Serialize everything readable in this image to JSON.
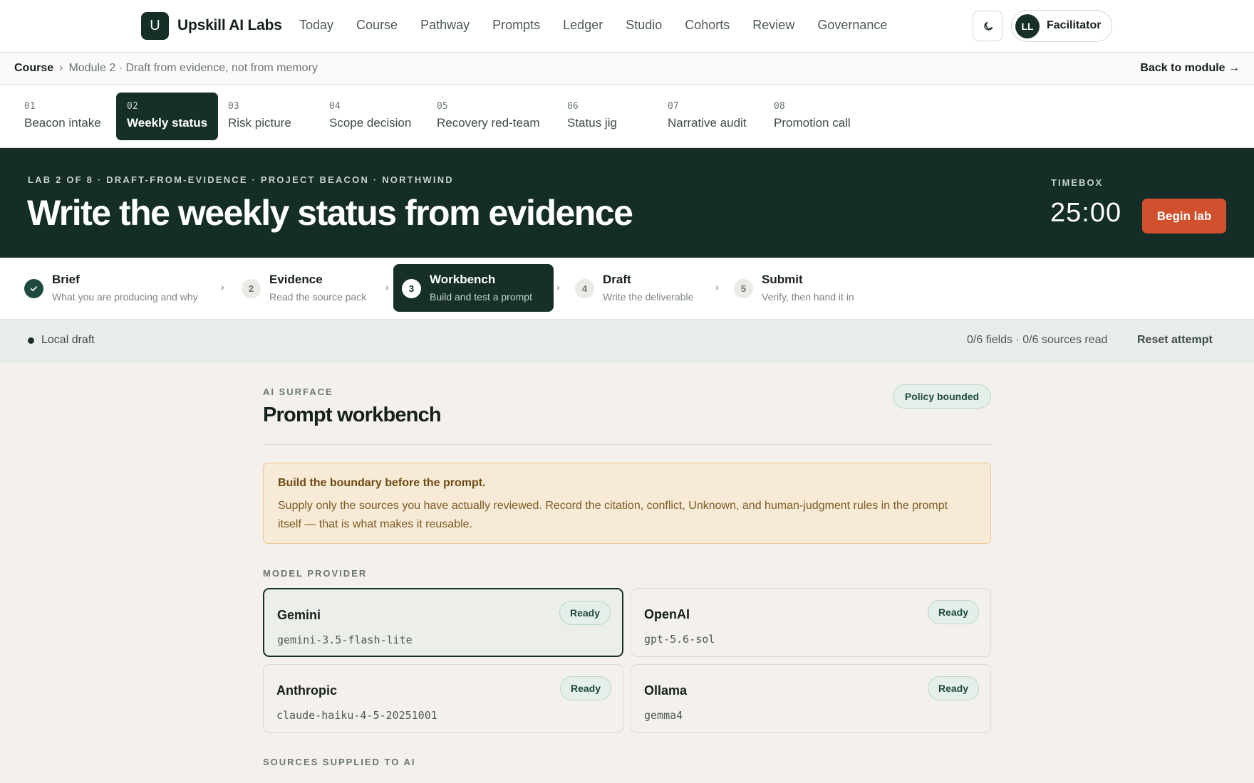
{
  "app": {
    "logo_letter": "U",
    "brand": "Upskill AI Labs",
    "nav": [
      "Today",
      "Course",
      "Pathway",
      "Prompts",
      "Ledger",
      "Studio",
      "Cohorts",
      "Review",
      "Governance"
    ],
    "user_initials": "LL",
    "user_role": "Facilitator"
  },
  "breadcrumb": {
    "root": "Course",
    "sep": "›",
    "current": "Module 2 · Draft from evidence, not from memory",
    "back": "Back to module →"
  },
  "lab_tabs": [
    {
      "num": "01",
      "label": "Beacon intake"
    },
    {
      "num": "02",
      "label": "Weekly status",
      "active": true
    },
    {
      "num": "03",
      "label": "Risk picture"
    },
    {
      "num": "04",
      "label": "Scope decision"
    },
    {
      "num": "05",
      "label": "Recovery red-team"
    },
    {
      "num": "06",
      "label": "Status jig"
    },
    {
      "num": "07",
      "label": "Narrative audit"
    },
    {
      "num": "08",
      "label": "Promotion call"
    }
  ],
  "hero": {
    "kicker": "LAB 2 OF 8 · DRAFT-FROM-EVIDENCE · PROJECT BEACON · NORTHWIND",
    "title": "Write the weekly status from evidence",
    "timebox_label": "TIMEBOX",
    "timebox_value": "25:00",
    "begin": "Begin lab"
  },
  "steps": [
    {
      "num": "✓",
      "title": "Brief",
      "sub": "What you are producing and why",
      "state": "done"
    },
    {
      "num": "2",
      "title": "Evidence",
      "sub": "Read the source pack",
      "state": "todo"
    },
    {
      "num": "3",
      "title": "Workbench",
      "sub": "Build and test a prompt",
      "state": "active"
    },
    {
      "num": "4",
      "title": "Draft",
      "sub": "Write the deliverable",
      "state": "todo"
    },
    {
      "num": "5",
      "title": "Submit",
      "sub": "Verify, then hand it in",
      "state": "todo"
    }
  ],
  "step_chevron": "›",
  "status": {
    "draft": "Local draft",
    "counts": "0/6 fields · 0/6 sources read",
    "reset": "Reset attempt"
  },
  "workbench": {
    "kicker": "AI SURFACE",
    "title": "Prompt workbench",
    "policy": "Policy bounded",
    "callout_title": "Build the boundary before the prompt.",
    "callout_body": "Supply only the sources you have actually reviewed. Record the citation, conflict, Unknown, and human-judgment rules in the prompt itself — that is what makes it reusable.",
    "provider_kicker": "MODEL PROVIDER",
    "providers": [
      {
        "name": "Gemini",
        "model": "gemini-3.5-flash-lite",
        "status": "Ready",
        "selected": true
      },
      {
        "name": "OpenAI",
        "model": "gpt-5.6-sol",
        "status": "Ready"
      },
      {
        "name": "Anthropic",
        "model": "claude-haiku-4-5-20251001",
        "status": "Ready"
      },
      {
        "name": "Ollama",
        "model": "gemma4",
        "status": "Ready"
      }
    ],
    "sources_kicker": "SOURCES SUPPLIED TO AI"
  }
}
